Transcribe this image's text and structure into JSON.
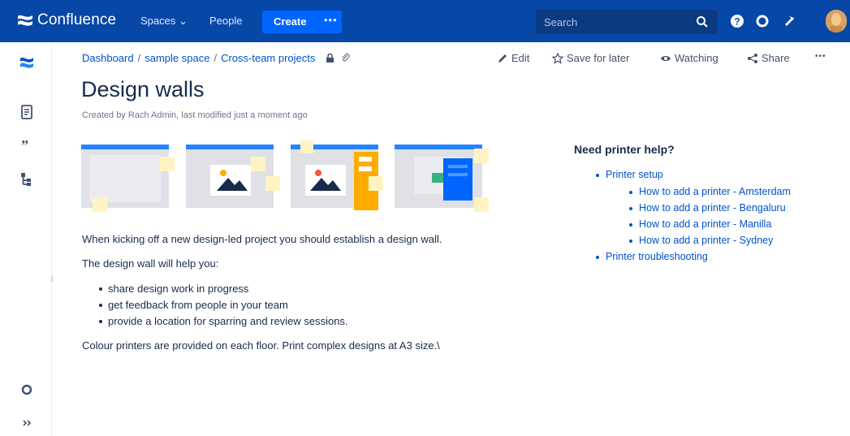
{
  "topnav": {
    "brand": "Confluence",
    "spaces_label": "Spaces ⌄",
    "people_label": "People",
    "create_label": "Create",
    "create_more": "•••",
    "search_placeholder": "Search",
    "icons": [
      "search-icon",
      "help-icon",
      "settings-icon",
      "notifications-icon",
      "avatar"
    ],
    "colors": {
      "nav_bg": "#0747a6",
      "create_bg": "#0065ff",
      "link": "#0052cc"
    }
  },
  "rail": {
    "icons": [
      "confluence-logo-icon",
      "pages-icon",
      "quote-icon",
      "page-tree-icon",
      "settings-icon",
      "expand-icon"
    ]
  },
  "breadcrumb": [
    "Dashboard",
    "sample space",
    "Cross-team projects"
  ],
  "actions": {
    "edit": "Edit",
    "save_for_later": "Save for later",
    "watching": "Watching",
    "share": "Share",
    "more": "•••"
  },
  "page": {
    "title": "Design walls",
    "byline": "Created by Rach Admin, last modified just a moment ago",
    "intro": "When kicking off a new design-led project you should establish a design wall.",
    "help_intro": "The design wall will help you:",
    "bullets": [
      "share design work in progress",
      "get feedback from people in your team",
      "provide a location for sparring and review sessions."
    ],
    "closing": "Colour printers are provided on each floor. Print complex designs at A3 size.\\"
  },
  "help": {
    "title": "Need printer help?",
    "setup": "Printer setup",
    "sub_items": [
      "How to add a printer - Amsterdam",
      "How to add a printer - Bengaluru",
      "How to add a printer - Manilla",
      "How to add a printer - Sydney"
    ],
    "troubleshooting": "Printer troubleshooting"
  }
}
